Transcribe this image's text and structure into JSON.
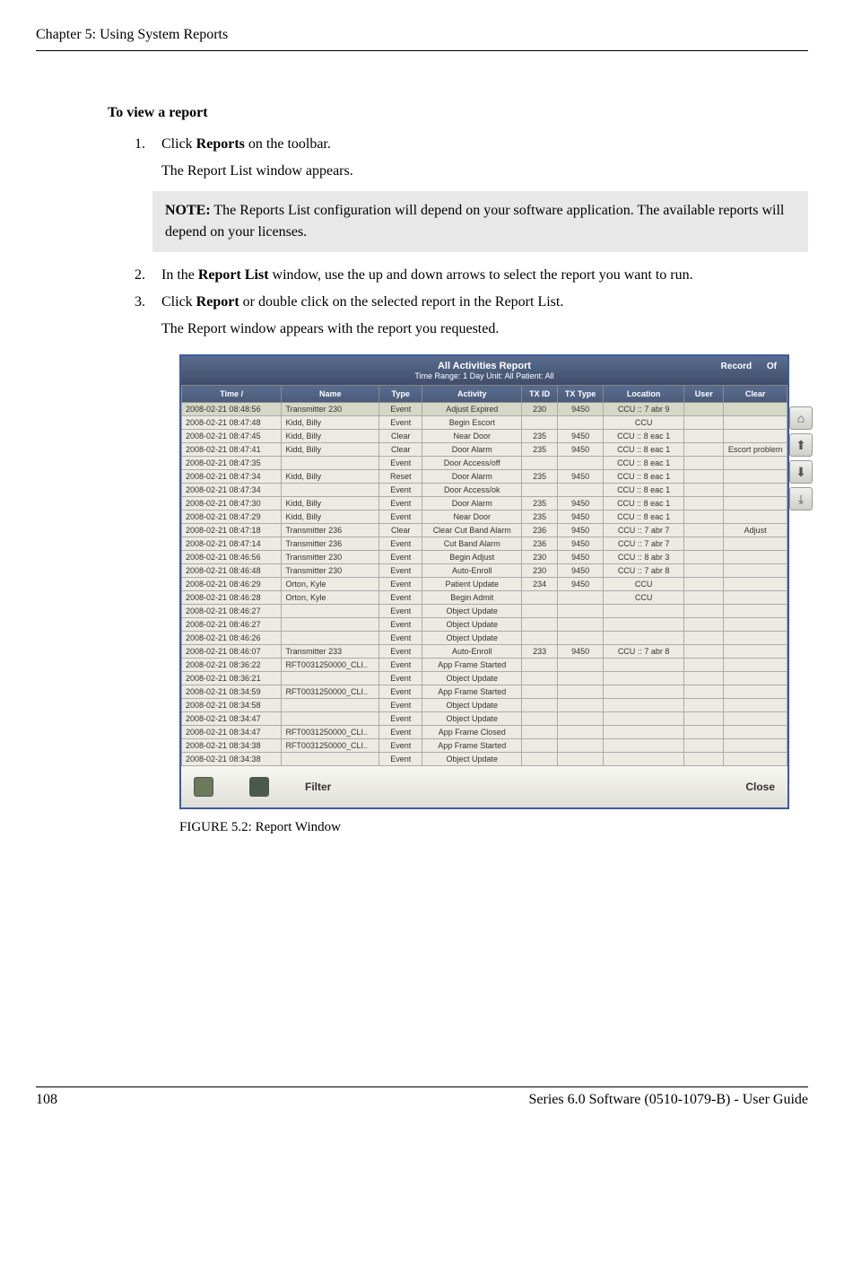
{
  "chapter_header": "Chapter 5: Using System Reports",
  "section_title": "To view a report",
  "steps": [
    {
      "num": "1.",
      "text_pre": "Click ",
      "bold": "Reports",
      "text_post": " on the toolbar.",
      "sub": "The Report List window appears."
    },
    {
      "num": "2.",
      "text_pre": "In the ",
      "bold": "Report List",
      "text_post": " window, use the up and down arrows to select the report you want to run."
    },
    {
      "num": "3.",
      "text_pre": "Click ",
      "bold": "Report",
      "text_post": " or double click on the selected report in the Report List.",
      "sub": "The Report window appears with the report you requested."
    }
  ],
  "note_label": "NOTE:",
  "note_text": "The Reports List configuration will depend on your software application. The available reports will depend on your licenses.",
  "report_window": {
    "title": "All Activities Report",
    "subtitle": "Time Range: 1 Day Unit: All Patient: All",
    "top_buttons": {
      "record": "Record",
      "of": "Of"
    },
    "columns": [
      "Time  /",
      "Name",
      "Type",
      "Activity",
      "TX ID",
      "TX Type",
      "Location",
      "User",
      "Clear"
    ],
    "rows": [
      {
        "time": "2008-02-21 08:48:56",
        "name": "Transmitter 230",
        "type": "Event",
        "activity": "Adjust Expired",
        "txid": "230",
        "txtype": "9450",
        "location": "CCU :: 7 abr 9",
        "user": "",
        "clear": "",
        "selected": true
      },
      {
        "time": "2008-02-21 08:47:48",
        "name": "Kidd, Billy",
        "type": "Event",
        "activity": "Begin Escort",
        "txid": "",
        "txtype": "",
        "location": "CCU",
        "user": "",
        "clear": ""
      },
      {
        "time": "2008-02-21 08:47:45",
        "name": "Kidd, Billy",
        "type": "Clear",
        "activity": "Near Door",
        "txid": "235",
        "txtype": "9450",
        "location": "CCU :: 8 eac 1",
        "user": "",
        "clear": ""
      },
      {
        "time": "2008-02-21 08:47:41",
        "name": "Kidd, Billy",
        "type": "Clear",
        "activity": "Door Alarm",
        "txid": "235",
        "txtype": "9450",
        "location": "CCU :: 8 eac 1",
        "user": "",
        "clear": "Escort problem"
      },
      {
        "time": "2008-02-21 08:47:35",
        "name": "",
        "type": "Event",
        "activity": "Door Access/off",
        "txid": "",
        "txtype": "",
        "location": "CCU :: 8 eac 1",
        "user": "",
        "clear": ""
      },
      {
        "time": "2008-02-21 08:47:34",
        "name": "Kidd, Billy",
        "type": "Reset",
        "activity": "Door Alarm",
        "txid": "235",
        "txtype": "9450",
        "location": "CCU :: 8 eac 1",
        "user": "",
        "clear": ""
      },
      {
        "time": "2008-02-21 08:47:34",
        "name": "",
        "type": "Event",
        "activity": "Door Access/ok",
        "txid": "",
        "txtype": "",
        "location": "CCU :: 8 eac 1",
        "user": "",
        "clear": ""
      },
      {
        "time": "2008-02-21 08:47:30",
        "name": "Kidd, Billy",
        "type": "Event",
        "activity": "Door Alarm",
        "txid": "235",
        "txtype": "9450",
        "location": "CCU :: 8 eac 1",
        "user": "",
        "clear": ""
      },
      {
        "time": "2008-02-21 08:47:29",
        "name": "Kidd, Billy",
        "type": "Event",
        "activity": "Near Door",
        "txid": "235",
        "txtype": "9450",
        "location": "CCU :: 8 eac 1",
        "user": "",
        "clear": ""
      },
      {
        "time": "2008-02-21 08:47:18",
        "name": "Transmitter 236",
        "type": "Clear",
        "activity": "Clear Cut Band Alarm",
        "txid": "236",
        "txtype": "9450",
        "location": "CCU :: 7 abr 7",
        "user": "",
        "clear": "Adjust"
      },
      {
        "time": "2008-02-21 08:47:14",
        "name": "Transmitter 236",
        "type": "Event",
        "activity": "Cut Band Alarm",
        "txid": "236",
        "txtype": "9450",
        "location": "CCU :: 7 abr 7",
        "user": "",
        "clear": ""
      },
      {
        "time": "2008-02-21 08:46:56",
        "name": "Transmitter 230",
        "type": "Event",
        "activity": "Begin Adjust",
        "txid": "230",
        "txtype": "9450",
        "location": "CCU :: 8 abr 3",
        "user": "",
        "clear": ""
      },
      {
        "time": "2008-02-21 08:46:48",
        "name": "Transmitter 230",
        "type": "Event",
        "activity": "Auto-Enroll",
        "txid": "230",
        "txtype": "9450",
        "location": "CCU :: 7 abr 8",
        "user": "",
        "clear": ""
      },
      {
        "time": "2008-02-21 08:46:29",
        "name": "Orton, Kyle",
        "type": "Event",
        "activity": "Patient Update",
        "txid": "234",
        "txtype": "9450",
        "location": "CCU",
        "user": "",
        "clear": ""
      },
      {
        "time": "2008-02-21 08:46:28",
        "name": "Orton, Kyle",
        "type": "Event",
        "activity": "Begin Admit",
        "txid": "",
        "txtype": "",
        "location": "CCU",
        "user": "",
        "clear": ""
      },
      {
        "time": "2008-02-21 08:46:27",
        "name": "",
        "type": "Event",
        "activity": "Object Update",
        "txid": "",
        "txtype": "",
        "location": "",
        "user": "",
        "clear": ""
      },
      {
        "time": "2008-02-21 08:46:27",
        "name": "",
        "type": "Event",
        "activity": "Object Update",
        "txid": "",
        "txtype": "",
        "location": "",
        "user": "",
        "clear": ""
      },
      {
        "time": "2008-02-21 08:46:26",
        "name": "",
        "type": "Event",
        "activity": "Object Update",
        "txid": "",
        "txtype": "",
        "location": "",
        "user": "",
        "clear": ""
      },
      {
        "time": "2008-02-21 08:46:07",
        "name": "Transmitter 233",
        "type": "Event",
        "activity": "Auto-Enroll",
        "txid": "233",
        "txtype": "9450",
        "location": "CCU :: 7 abr 8",
        "user": "",
        "clear": ""
      },
      {
        "time": "2008-02-21 08:36:22",
        "name": "RFT0031250000_CLI..",
        "type": "Event",
        "activity": "App Frame Started",
        "txid": "",
        "txtype": "",
        "location": "",
        "user": "",
        "clear": ""
      },
      {
        "time": "2008-02-21 08:36:21",
        "name": "",
        "type": "Event",
        "activity": "Object Update",
        "txid": "",
        "txtype": "",
        "location": "",
        "user": "",
        "clear": ""
      },
      {
        "time": "2008-02-21 08:34:59",
        "name": "RFT0031250000_CLI..",
        "type": "Event",
        "activity": "App Frame Started",
        "txid": "",
        "txtype": "",
        "location": "",
        "user": "",
        "clear": ""
      },
      {
        "time": "2008-02-21 08:34:58",
        "name": "",
        "type": "Event",
        "activity": "Object Update",
        "txid": "",
        "txtype": "",
        "location": "",
        "user": "",
        "clear": ""
      },
      {
        "time": "2008-02-21 08:34:47",
        "name": "",
        "type": "Event",
        "activity": "Object Update",
        "txid": "",
        "txtype": "",
        "location": "",
        "user": "",
        "clear": ""
      },
      {
        "time": "2008-02-21 08:34:47",
        "name": "RFT0031250000_CLI..",
        "type": "Event",
        "activity": "App Frame Closed",
        "txid": "",
        "txtype": "",
        "location": "",
        "user": "",
        "clear": ""
      },
      {
        "time": "2008-02-21 08:34:38",
        "name": "RFT0031250000_CLI..",
        "type": "Event",
        "activity": "App Frame Started",
        "txid": "",
        "txtype": "",
        "location": "",
        "user": "",
        "clear": ""
      },
      {
        "time": "2008-02-21 08:34:38",
        "name": "",
        "type": "Event",
        "activity": "Object Update",
        "txid": "",
        "txtype": "",
        "location": "",
        "user": "",
        "clear": ""
      }
    ],
    "bottom": {
      "filter": "Filter",
      "close": "Close"
    }
  },
  "figure_caption": "FIGURE 5.2:    Report Window",
  "footer_left": "108",
  "footer_right": "Series 6.0 Software (0510-1079-B) - User Guide"
}
